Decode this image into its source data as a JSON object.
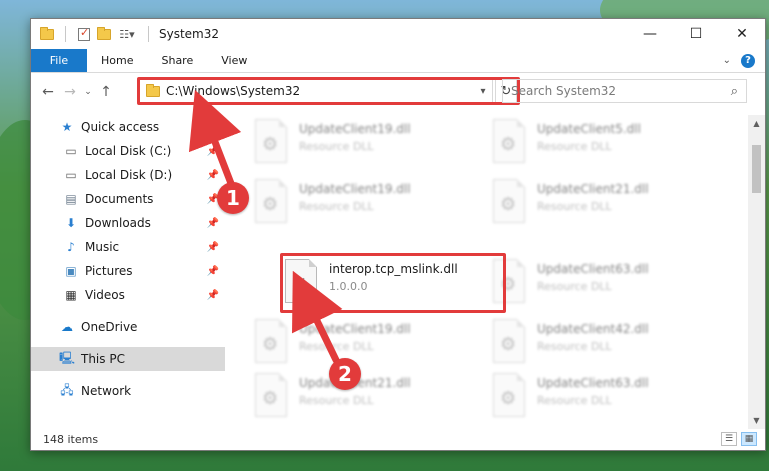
{
  "window": {
    "title": "System32",
    "controls": {
      "minimize": "—",
      "maximize": "☐",
      "close": "✕"
    }
  },
  "ribbon": {
    "tabs": [
      "File",
      "Home",
      "Share",
      "View"
    ],
    "help": "?"
  },
  "address_bar": {
    "path": "C:\\Windows\\System32",
    "dropdown": "▾",
    "refresh": "↻"
  },
  "search": {
    "placeholder": "Search System32",
    "icon": "⌕"
  },
  "navigation": {
    "quick_access": {
      "label": "Quick access",
      "items": [
        {
          "label": "Local Disk (C:)",
          "icon": "drive-icon",
          "pinned": true
        },
        {
          "label": "Local Disk (D:)",
          "icon": "drive-icon",
          "pinned": true
        },
        {
          "label": "Documents",
          "icon": "documents-icon",
          "pinned": true
        },
        {
          "label": "Downloads",
          "icon": "downloads-icon",
          "pinned": true
        },
        {
          "label": "Music",
          "icon": "music-icon",
          "pinned": true
        },
        {
          "label": "Pictures",
          "icon": "pictures-icon",
          "pinned": true
        },
        {
          "label": "Videos",
          "icon": "videos-icon",
          "pinned": true
        }
      ]
    },
    "onedrive": "OneDrive",
    "this_pc": "This PC",
    "network": "Network"
  },
  "files": [
    {
      "name": "UpdateClient19.dll",
      "desc": "Resource DLL",
      "blurred": true
    },
    {
      "name": "UpdateClient5.dll",
      "desc": "Resource DLL",
      "blurred": true
    },
    {
      "name": "UpdateClient19.dll",
      "desc": "Resource DLL",
      "blurred": true
    },
    {
      "name": "UpdateClient21.dll",
      "desc": "Resource DLL",
      "blurred": true
    },
    {
      "name": "interop.tcp_mslink.dll",
      "desc": "1.0.0.0",
      "blurred": false
    },
    {
      "name": "UpdateClient63.dll",
      "desc": "Resource DLL",
      "blurred": true
    },
    {
      "name": "UpdateClient19.dll",
      "desc": "Resource DLL",
      "blurred": true
    },
    {
      "name": "UpdateClient42.dll",
      "desc": "Resource DLL",
      "blurred": true
    },
    {
      "name": "UpdateClient21.dll",
      "desc": "Resource DLL",
      "blurred": true
    },
    {
      "name": "UpdateClient63.dll",
      "desc": "Resource DLL",
      "blurred": true
    }
  ],
  "status": {
    "item_count": "148 items"
  },
  "callouts": [
    "1",
    "2"
  ],
  "colors": {
    "accent": "#1979ca",
    "highlight": "#e23b3b",
    "selected": "#cce8ff"
  }
}
